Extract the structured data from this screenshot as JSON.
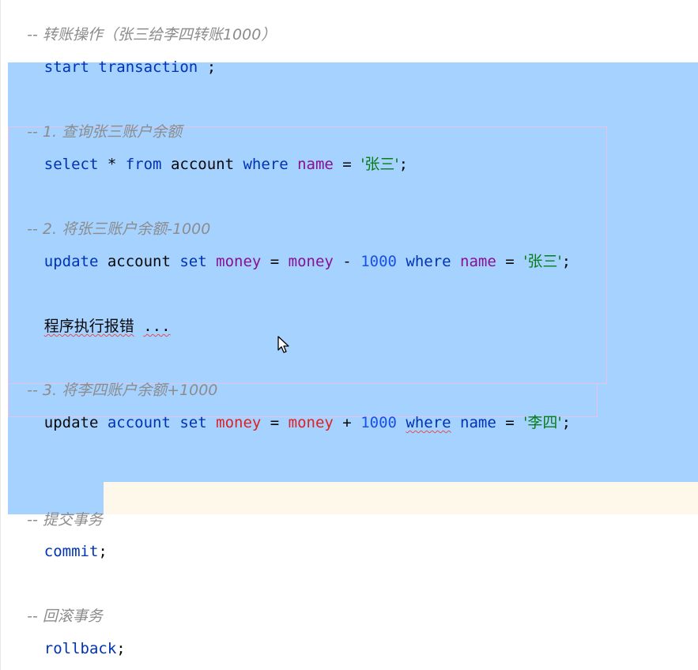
{
  "editor": {
    "lines": {
      "l1": {
        "comment": "-- 转账操作（张三给李四转账1000）"
      },
      "l2": {
        "kw_start": "start",
        "kw_transaction": "transaction",
        "semi": " ;"
      },
      "l3": {
        "comment": "-- 1. 查询张三账户余额"
      },
      "l4": {
        "kw_select": "select",
        "star": " * ",
        "kw_from": "from",
        "table": " account ",
        "kw_where": "where",
        "col_name": " name",
        "eq": " = ",
        "str": "'张三'",
        "semi": ";"
      },
      "l5": {
        "comment": "-- 2. 将张三账户余额-1000"
      },
      "l6": {
        "kw_update": "update",
        "table": " account ",
        "kw_set": "set",
        "col_money1": " money",
        "eq": " = ",
        "col_money2": "money",
        "minus": " - ",
        "num": "1000",
        "kw_where": " where",
        "col_name": " name",
        "eq2": " = ",
        "str": "'张三'",
        "semi": ";"
      },
      "l7": {
        "text": "程序执行报错",
        "dots": "..."
      },
      "l8": {
        "comment": "-- 3. 将李四账户余额+1000"
      },
      "l9": {
        "kw_update": "update",
        "table": " account ",
        "kw_set": "set",
        "col_money1": " money",
        "eq": " = ",
        "col_money2": "money",
        "plus": " + ",
        "num": "1000",
        "kw_where": "where",
        "col_name": " name",
        "eq2": " = ",
        "str": "'李四'",
        "semi": ";"
      },
      "l10": {
        "comment": "-- 提交事务"
      },
      "l11": {
        "kw_commit": "commit",
        "semi": ";"
      },
      "l12": {
        "comment": "-- 回滚事务"
      },
      "l13": {
        "kw_rollback": "rollback",
        "semi": ";"
      }
    },
    "colors": {
      "selection": "#a6d2ff",
      "keyword": "#0033b3",
      "column": "#871094",
      "number": "#1750eb",
      "string": "#067d17",
      "comment": "#8c8c8c"
    }
  }
}
